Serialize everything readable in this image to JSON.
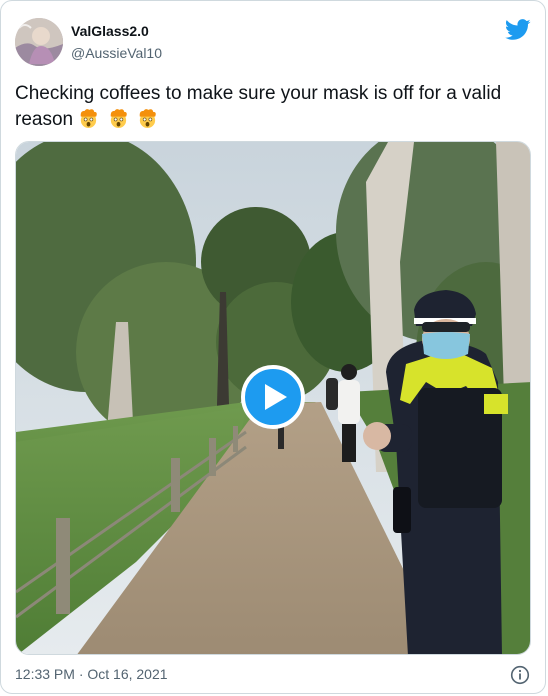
{
  "user": {
    "display_name": "ValGlass2.0",
    "handle": "@AussieVal10",
    "avatar_icon": "avatar-photo"
  },
  "brand": {
    "icon": "twitter-bird-icon",
    "color": "#1d9bf0"
  },
  "tweet": {
    "text": "Checking coffees to make sure your mask is off for a valid reason",
    "emojis": [
      "exploding-head-emoji",
      "exploding-head-emoji",
      "exploding-head-emoji"
    ]
  },
  "media": {
    "type": "video",
    "play_icon": "play-icon"
  },
  "footer": {
    "timestamp": "12:33 PM · Oct 16, 2021",
    "info_icon": "info-icon"
  },
  "colors": {
    "text_primary": "#0f1419",
    "text_secondary": "#536471",
    "border": "#cfd9de",
    "accent": "#1d9bf0"
  }
}
